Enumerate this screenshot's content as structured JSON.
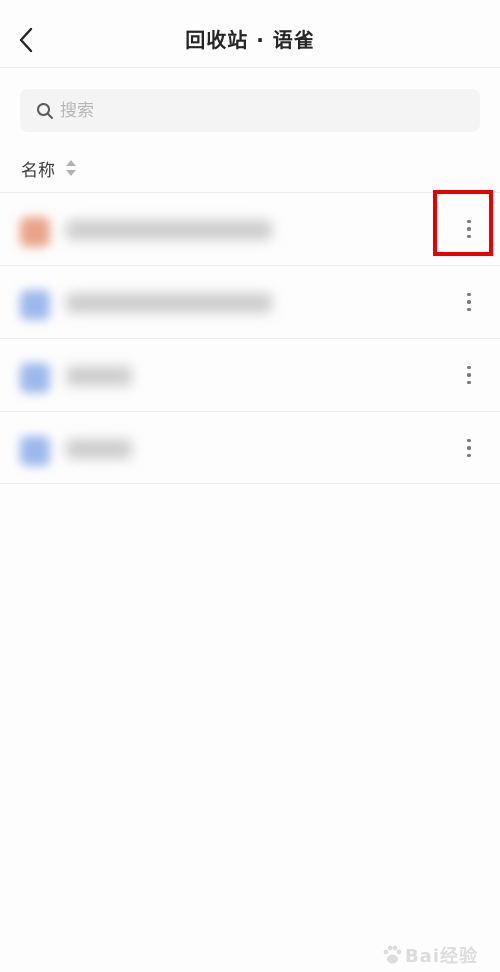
{
  "header": {
    "title": "回收站 · 语雀",
    "back_icon": "chevron-left-icon"
  },
  "search": {
    "placeholder": "搜索",
    "value": "",
    "icon": "search-icon"
  },
  "sort": {
    "label": "名称",
    "icon": "sort-arrows-icon"
  },
  "files": [
    {
      "name": "",
      "icon_color": "#e9a48a",
      "more_icon": "more-vertical-icon"
    },
    {
      "name": "",
      "icon_color": "#9db9ec",
      "more_icon": "more-vertical-icon"
    },
    {
      "name": "",
      "icon_color": "#9db9ec",
      "more_icon": "more-vertical-icon"
    },
    {
      "name": "",
      "icon_color": "#9db9ec",
      "more_icon": "more-vertical-icon"
    }
  ],
  "annotation": {
    "color": "#e60000"
  },
  "watermark": {
    "text": "Bai经验",
    "color": "#dcdcdc"
  }
}
